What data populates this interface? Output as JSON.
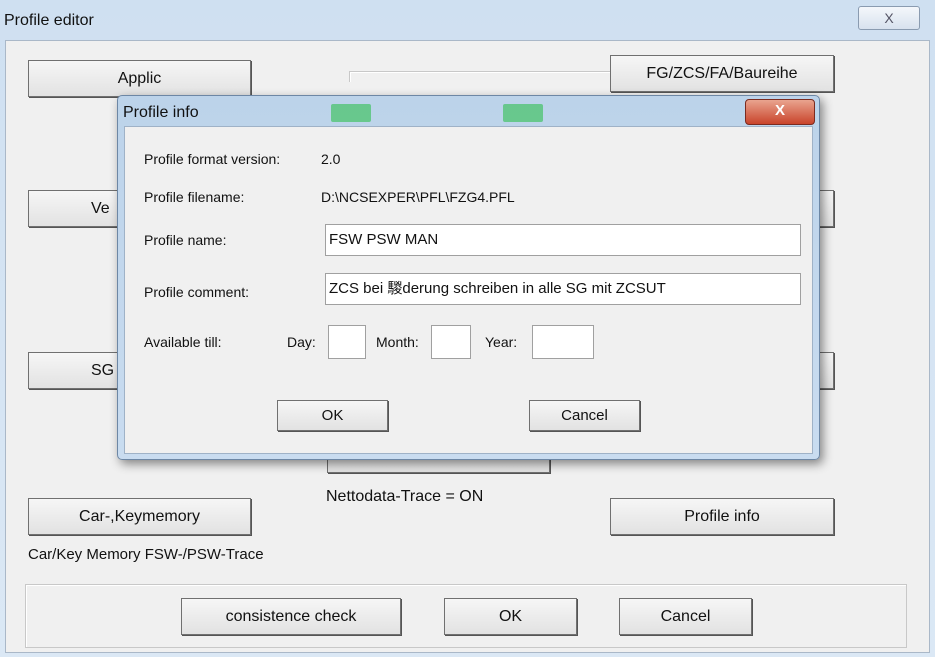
{
  "window": {
    "title": "Profile editor",
    "close_label": "X"
  },
  "editor": {
    "applic": "Applic",
    "fg_zcs": "FG/ZCS/FA/Baureihe",
    "ve_partial": "Ve",
    "sg_partial": "SG",
    "car_keymemory": "Car-,Keymemory",
    "car_key_status": "Car/Key Memory FSW-/PSW-Trace",
    "nettodata_status": "Nettodata-Trace = ON",
    "profile_info": "Profile info",
    "consistence_check": "consistence check",
    "ok": "OK",
    "cancel": "Cancel"
  },
  "dialog": {
    "title": "Profile info",
    "close_label": "X",
    "format_version_label": "Profile format version:",
    "format_version": "2.0",
    "filename_label": "Profile filename:",
    "filename": "D:\\NCSEXPER\\PFL\\FZG4.PFL",
    "name_label": "Profile name:",
    "name_value": "FSW PSW MAN",
    "comment_label": "Profile comment:",
    "comment_value": "ZCS bei 騣derung schreiben in alle SG mit ZCSUT",
    "available_label": "Available till:",
    "day_label": "Day:",
    "month_label": "Month:",
    "year_label": "Year:",
    "day_value": "",
    "month_value": "",
    "year_value": "",
    "ok": "OK",
    "cancel": "Cancel"
  }
}
